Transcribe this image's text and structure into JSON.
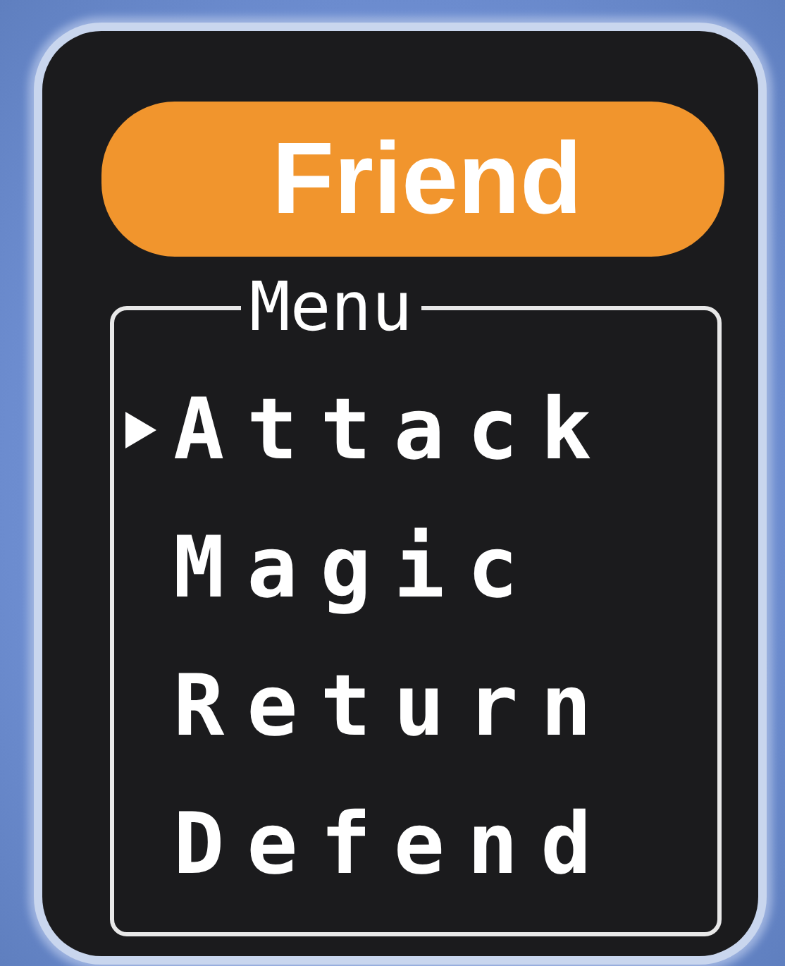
{
  "header": {
    "title": "Friend"
  },
  "menu": {
    "title": "Menu",
    "items": [
      {
        "label": "Attack",
        "selected": true
      },
      {
        "label": "Magic",
        "selected": false
      },
      {
        "label": "Return",
        "selected": false
      },
      {
        "label": "Defend",
        "selected": false
      }
    ]
  }
}
